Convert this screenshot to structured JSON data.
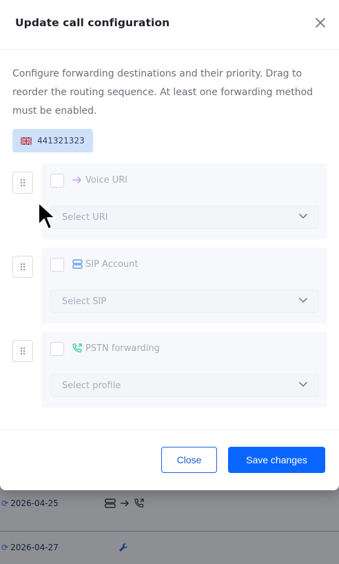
{
  "modal": {
    "title": "Update call configuration",
    "description": "Configure forwarding destinations and their priority. Drag to reorder the routing sequence. At least one forwarding method must be enabled.",
    "phone_number": "441321323",
    "flag_icon": "uk-flag-icon",
    "methods": [
      {
        "label": "Voice URI",
        "icon": "arrow-right-icon",
        "icon_color": "#c79be3",
        "select_placeholder": "Select URI",
        "enabled": false
      },
      {
        "label": "SIP Account",
        "icon": "server-icon",
        "icon_color": "#5b9bf0",
        "select_placeholder": "Select SIP",
        "enabled": false
      },
      {
        "label": "PSTN forwarding",
        "icon": "phone-forward-icon",
        "icon_color": "#3cc9a8",
        "select_placeholder": "Select profile",
        "enabled": false
      }
    ],
    "close_label": "Close",
    "save_label": "Save changes"
  },
  "background": {
    "rows": [
      {
        "date": "2026-04-25"
      },
      {
        "date": "2026-04-27"
      }
    ]
  },
  "colors": {
    "primary": "#0a66ff",
    "chip_bg": "#cfe0fb"
  }
}
